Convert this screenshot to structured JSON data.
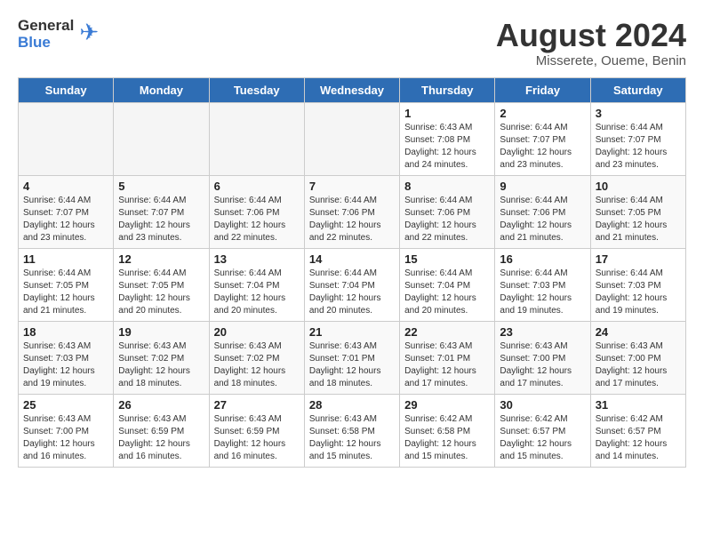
{
  "header": {
    "logo_general": "General",
    "logo_blue": "Blue",
    "month_title": "August 2024",
    "subtitle": "Misserete, Oueme, Benin"
  },
  "days_of_week": [
    "Sunday",
    "Monday",
    "Tuesday",
    "Wednesday",
    "Thursday",
    "Friday",
    "Saturday"
  ],
  "weeks": [
    [
      {
        "day": "",
        "info": ""
      },
      {
        "day": "",
        "info": ""
      },
      {
        "day": "",
        "info": ""
      },
      {
        "day": "",
        "info": ""
      },
      {
        "day": "1",
        "info": "Sunrise: 6:43 AM\nSunset: 7:08 PM\nDaylight: 12 hours\nand 24 minutes."
      },
      {
        "day": "2",
        "info": "Sunrise: 6:44 AM\nSunset: 7:07 PM\nDaylight: 12 hours\nand 23 minutes."
      },
      {
        "day": "3",
        "info": "Sunrise: 6:44 AM\nSunset: 7:07 PM\nDaylight: 12 hours\nand 23 minutes."
      }
    ],
    [
      {
        "day": "4",
        "info": "Sunrise: 6:44 AM\nSunset: 7:07 PM\nDaylight: 12 hours\nand 23 minutes."
      },
      {
        "day": "5",
        "info": "Sunrise: 6:44 AM\nSunset: 7:07 PM\nDaylight: 12 hours\nand 23 minutes."
      },
      {
        "day": "6",
        "info": "Sunrise: 6:44 AM\nSunset: 7:06 PM\nDaylight: 12 hours\nand 22 minutes."
      },
      {
        "day": "7",
        "info": "Sunrise: 6:44 AM\nSunset: 7:06 PM\nDaylight: 12 hours\nand 22 minutes."
      },
      {
        "day": "8",
        "info": "Sunrise: 6:44 AM\nSunset: 7:06 PM\nDaylight: 12 hours\nand 22 minutes."
      },
      {
        "day": "9",
        "info": "Sunrise: 6:44 AM\nSunset: 7:06 PM\nDaylight: 12 hours\nand 21 minutes."
      },
      {
        "day": "10",
        "info": "Sunrise: 6:44 AM\nSunset: 7:05 PM\nDaylight: 12 hours\nand 21 minutes."
      }
    ],
    [
      {
        "day": "11",
        "info": "Sunrise: 6:44 AM\nSunset: 7:05 PM\nDaylight: 12 hours\nand 21 minutes."
      },
      {
        "day": "12",
        "info": "Sunrise: 6:44 AM\nSunset: 7:05 PM\nDaylight: 12 hours\nand 20 minutes."
      },
      {
        "day": "13",
        "info": "Sunrise: 6:44 AM\nSunset: 7:04 PM\nDaylight: 12 hours\nand 20 minutes."
      },
      {
        "day": "14",
        "info": "Sunrise: 6:44 AM\nSunset: 7:04 PM\nDaylight: 12 hours\nand 20 minutes."
      },
      {
        "day": "15",
        "info": "Sunrise: 6:44 AM\nSunset: 7:04 PM\nDaylight: 12 hours\nand 20 minutes."
      },
      {
        "day": "16",
        "info": "Sunrise: 6:44 AM\nSunset: 7:03 PM\nDaylight: 12 hours\nand 19 minutes."
      },
      {
        "day": "17",
        "info": "Sunrise: 6:44 AM\nSunset: 7:03 PM\nDaylight: 12 hours\nand 19 minutes."
      }
    ],
    [
      {
        "day": "18",
        "info": "Sunrise: 6:43 AM\nSunset: 7:03 PM\nDaylight: 12 hours\nand 19 minutes."
      },
      {
        "day": "19",
        "info": "Sunrise: 6:43 AM\nSunset: 7:02 PM\nDaylight: 12 hours\nand 18 minutes."
      },
      {
        "day": "20",
        "info": "Sunrise: 6:43 AM\nSunset: 7:02 PM\nDaylight: 12 hours\nand 18 minutes."
      },
      {
        "day": "21",
        "info": "Sunrise: 6:43 AM\nSunset: 7:01 PM\nDaylight: 12 hours\nand 18 minutes."
      },
      {
        "day": "22",
        "info": "Sunrise: 6:43 AM\nSunset: 7:01 PM\nDaylight: 12 hours\nand 17 minutes."
      },
      {
        "day": "23",
        "info": "Sunrise: 6:43 AM\nSunset: 7:00 PM\nDaylight: 12 hours\nand 17 minutes."
      },
      {
        "day": "24",
        "info": "Sunrise: 6:43 AM\nSunset: 7:00 PM\nDaylight: 12 hours\nand 17 minutes."
      }
    ],
    [
      {
        "day": "25",
        "info": "Sunrise: 6:43 AM\nSunset: 7:00 PM\nDaylight: 12 hours\nand 16 minutes."
      },
      {
        "day": "26",
        "info": "Sunrise: 6:43 AM\nSunset: 6:59 PM\nDaylight: 12 hours\nand 16 minutes."
      },
      {
        "day": "27",
        "info": "Sunrise: 6:43 AM\nSunset: 6:59 PM\nDaylight: 12 hours\nand 16 minutes."
      },
      {
        "day": "28",
        "info": "Sunrise: 6:43 AM\nSunset: 6:58 PM\nDaylight: 12 hours\nand 15 minutes."
      },
      {
        "day": "29",
        "info": "Sunrise: 6:42 AM\nSunset: 6:58 PM\nDaylight: 12 hours\nand 15 minutes."
      },
      {
        "day": "30",
        "info": "Sunrise: 6:42 AM\nSunset: 6:57 PM\nDaylight: 12 hours\nand 15 minutes."
      },
      {
        "day": "31",
        "info": "Sunrise: 6:42 AM\nSunset: 6:57 PM\nDaylight: 12 hours\nand 14 minutes."
      }
    ]
  ]
}
